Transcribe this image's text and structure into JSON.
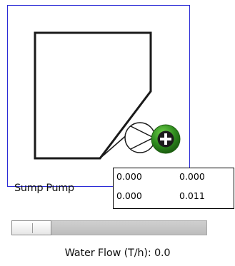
{
  "component": {
    "label": "Sump Pump",
    "selected": true,
    "add_icon": "plus-circle-icon",
    "accent_color": "#2e8b1e",
    "selection_color": "#2b2bd6"
  },
  "values": {
    "row1": [
      "0.000",
      "0.000"
    ],
    "row2": [
      "0.000",
      "0.011"
    ]
  },
  "flow_slider": {
    "value_fraction": 0.0
  },
  "water_flow": {
    "label": "Water Flow (T/h):",
    "value": "0.0"
  }
}
